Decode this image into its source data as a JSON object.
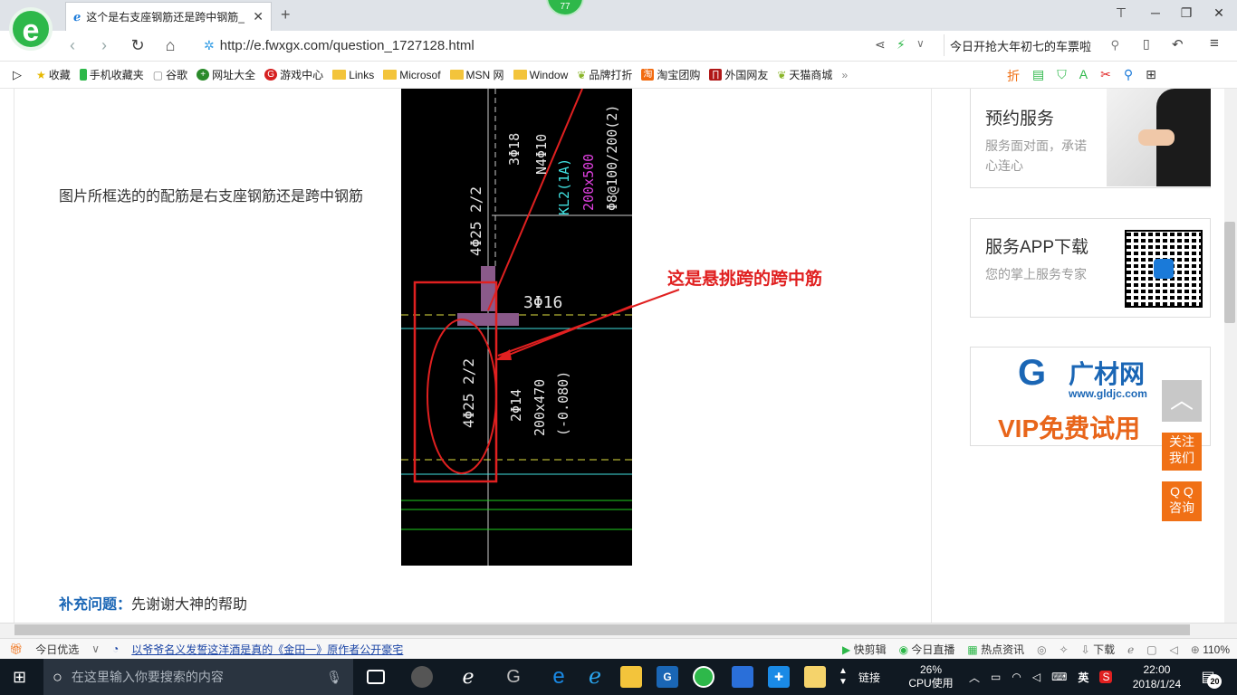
{
  "browser": {
    "tab_title": "这个是右支座钢筋还是跨中钢筋_",
    "badge": "77",
    "url": "http://e.fwxgx.com/question_1727128.html",
    "search_text": "今日开抢大年初七的车票啦",
    "logo_letter": "e"
  },
  "bookmarks": [
    {
      "label": "收藏",
      "icon": "star-icon"
    },
    {
      "label": "手机收藏夹",
      "icon": "phone-icon"
    },
    {
      "label": "谷歌",
      "icon": "page-icon"
    },
    {
      "label": "网址大全",
      "icon": "nav-icon"
    },
    {
      "label": "游戏中心",
      "icon": "game-icon"
    },
    {
      "label": "Links",
      "icon": "folder-icon"
    },
    {
      "label": "Microsof",
      "icon": "folder-icon"
    },
    {
      "label": "MSN 网",
      "icon": "folder-icon"
    },
    {
      "label": "Window",
      "icon": "folder-icon"
    },
    {
      "label": "品牌打折",
      "icon": "leaf-icon"
    },
    {
      "label": "淘宝团购",
      "icon": "taobao-icon"
    },
    {
      "label": "外国网友",
      "icon": "flag-icon"
    },
    {
      "label": "天猫商城",
      "icon": "leaf-icon"
    }
  ],
  "page": {
    "question": "图片所框选的的配筋是右支座钢筋还是跨中钢筋",
    "annotation": "这是悬挑跨的跨中筋",
    "supplement_label": "补充问题：",
    "supplement_text": "先谢谢大神的帮助",
    "cad_labels": {
      "top_rebar": "4Φ25 2/2",
      "n_rebar": "3Φ18",
      "n4": "N4Φ10",
      "kl": "KL2(1A)",
      "size1": "200x500",
      "stirrup": "Φ8@100/200(2)",
      "mid": "3Φ16",
      "bottom_rebar": "4Φ25 2/2",
      "b2": "2Φ14",
      "size2": "200x470",
      "elev": "(-0.080)"
    }
  },
  "sidebar": {
    "card1_title": "预约服务",
    "card1_desc": "服务面对面，承诺心连心",
    "card2_title": "服务APP下载",
    "card2_desc": "您的掌上服务专家",
    "ad_brand": "广材网",
    "ad_url": "www.gldjc.com",
    "ad_text": "VIP免费试用",
    "follow_btn": "关注我们",
    "qq_btn": "Q Q 咨询"
  },
  "status": {
    "left": "今日优选",
    "news": "以爷爷名义发誓这洋酒是真的《金田一》原作者公开豪宅",
    "kuaijian": "快剪辑",
    "live": "今日直播",
    "hot": "热点资讯",
    "download": "下载",
    "zoom": "110%"
  },
  "taskbar": {
    "search_placeholder": "在这里输入你要搜索的内容",
    "links": "链接",
    "cpu_pct": "26%",
    "cpu_label": "CPU使用",
    "ime": "英",
    "time": "22:00",
    "date": "2018/1/24",
    "notif": "20"
  },
  "colors": {
    "accent_green": "#2eb84a",
    "cad_bg": "#000000",
    "annotation_red": "#e02020",
    "side_orange": "#f07015"
  }
}
